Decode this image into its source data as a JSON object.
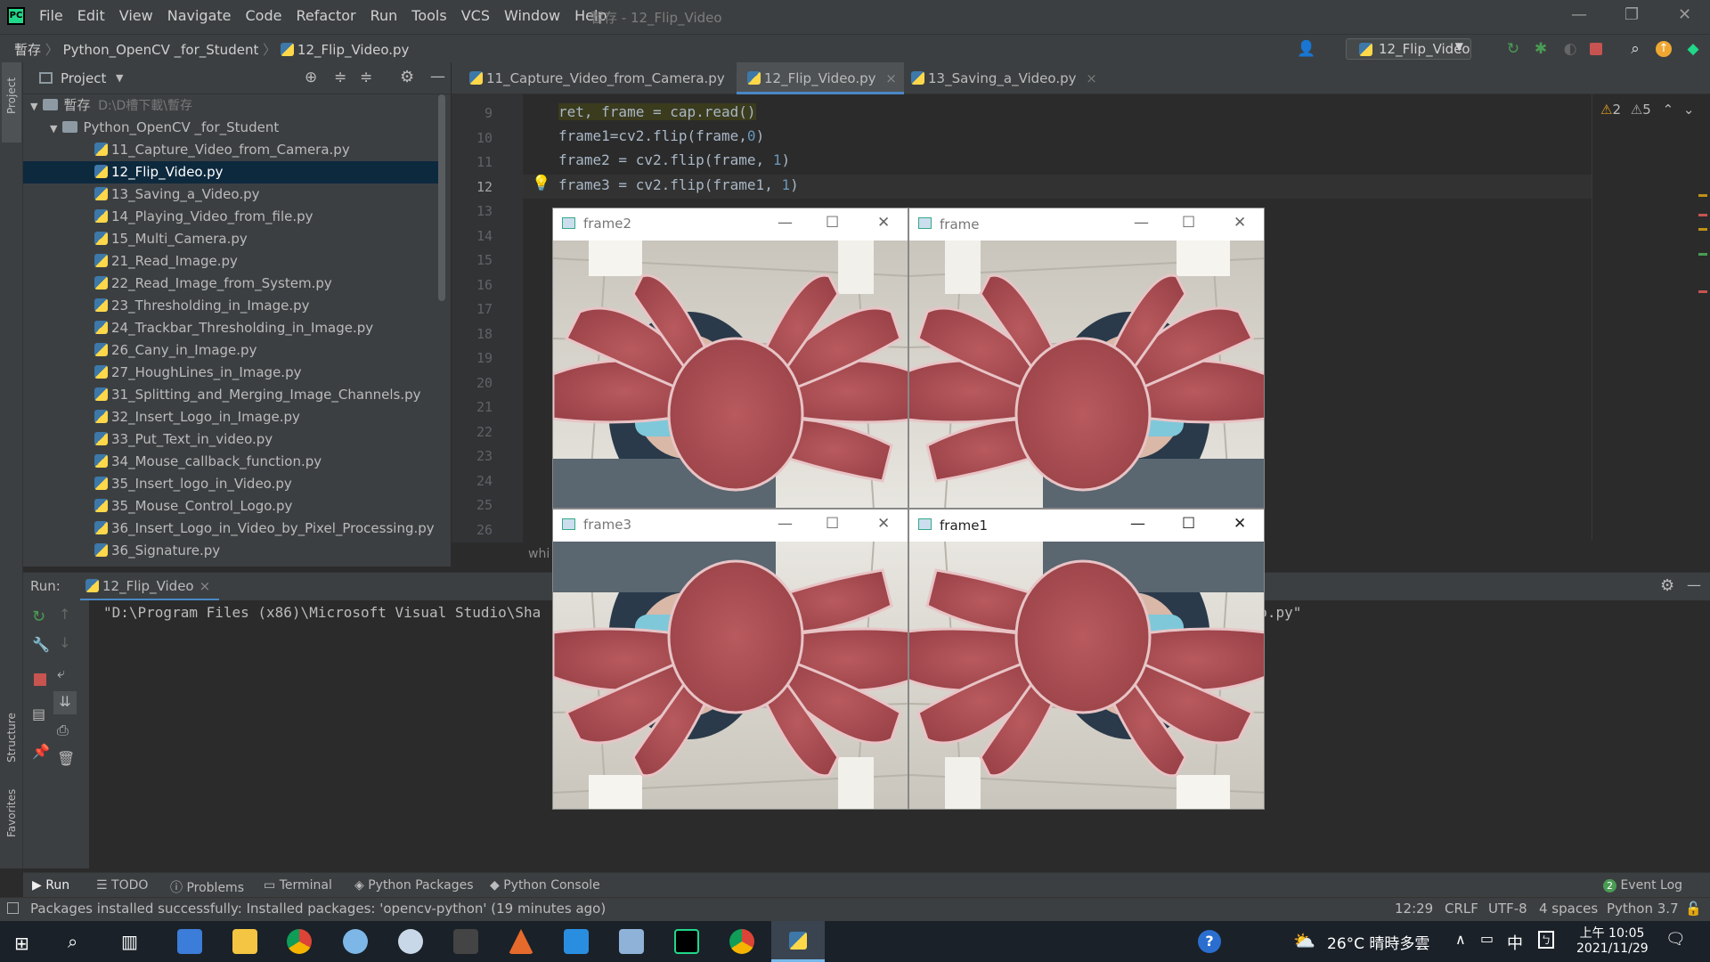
{
  "menu": [
    "File",
    "Edit",
    "View",
    "Navigate",
    "Code",
    "Refactor",
    "Run",
    "Tools",
    "VCS",
    "Window",
    "Help"
  ],
  "window_title": "暫存 - 12_Flip_Video",
  "breadcrumb": [
    "暫存",
    "Python_OpenCV _for_Student",
    "12_Flip_Video.py"
  ],
  "run_config": "12_Flip_Video",
  "project_label": "Project",
  "sidebar_labels": {
    "project": "Project",
    "structure": "Structure",
    "favorites": "Favorites"
  },
  "tree": {
    "root": "暫存",
    "root_path": "D:\\D槽下載\\暫存",
    "folder": "Python_OpenCV _for_Student",
    "files": [
      "11_Capture_Video_from_Camera.py",
      "12_Flip_Video.py",
      "13_Saving_a_Video.py",
      "14_Playing_Video_from_file.py",
      "15_Multi_Camera.py",
      "21_Read_Image.py",
      "22_Read_Image_from_System.py",
      "23_Thresholding_in_Image.py",
      "24_Trackbar_Thresholding_in_Image.py",
      "26_Cany_in_Image.py",
      "27_HoughLines_in_Image.py",
      "31_Splitting_and_Merging_Image_Channels.py",
      "32_Insert_Logo_in_Image.py",
      "33_Put_Text_in_video.py",
      "34_Mouse_callback_function.py",
      "35_Insert_logo_in_Video.py",
      "35_Mouse_Control_Logo.py",
      "36_Insert_Logo_in_Video_by_Pixel_Processing.py",
      "36_Signature.py"
    ],
    "selected": 1
  },
  "tabs": [
    "11_Capture_Video_from_Camera.py",
    "12_Flip_Video.py",
    "13_Saving_a_Video.py"
  ],
  "active_tab": 1,
  "line_numbers": [
    "9",
    "10",
    "11",
    "12",
    "13",
    "14",
    "15",
    "16",
    "17",
    "18",
    "19",
    "20",
    "21",
    "22",
    "23",
    "24",
    "25",
    "26"
  ],
  "code": {
    "l9": "ret, frame = cap.read()",
    "l10a": "frame1=cv2.flip(frame,",
    "l10b": "0",
    "l10c": ")",
    "l11a": "frame2 = cv2.flip(frame, ",
    "l11b": "1",
    "l11c": ")",
    "l12a": "frame3 = cv2.flip(frame1, ",
    "l12b": "1",
    "l12c": ")",
    "trailing": "whi"
  },
  "inspections": {
    "warn1": "2",
    "warn2": "5"
  },
  "run": {
    "label": "Run:",
    "tab": "12_Flip_Video",
    "console_start": "\"D:\\Program Files (x86)\\Microsoft Visual Studio\\Sha",
    "console_end": "deo.py\""
  },
  "cv_windows": {
    "frame2": "frame2",
    "frame": "frame",
    "frame3": "frame3",
    "frame1": "frame1"
  },
  "bottom_tabs": [
    "Run",
    "TODO",
    "Problems",
    "Terminal",
    "Python Packages",
    "Python Console"
  ],
  "event_log": "Event Log",
  "event_count": "2",
  "status": {
    "message": "Packages installed successfully: Installed packages: 'opencv-python' (19 minutes ago)",
    "pos": "12:29",
    "eol": "CRLF",
    "enc": "UTF-8",
    "indent": "4 spaces",
    "interp": "Python 3.7"
  },
  "taskbar": {
    "weather": "26°C 晴時多雲",
    "ime": "中",
    "time": "上午 10:05",
    "date": "2021/11/29"
  },
  "colors": {
    "accent": "#4a88c7",
    "pycharm": "#21d789",
    "error_red": "#c75450",
    "green": "#499c54"
  }
}
